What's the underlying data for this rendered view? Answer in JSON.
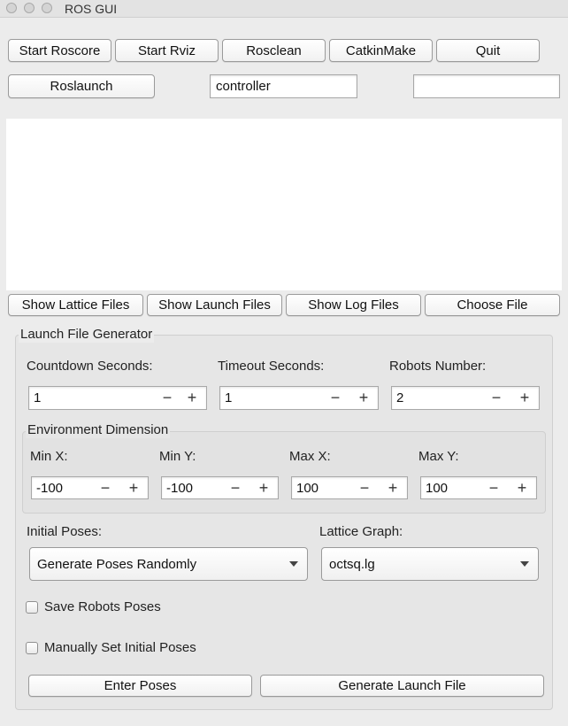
{
  "window": {
    "title": "ROS GUI"
  },
  "toolbar": {
    "row1": [
      "Start Roscore",
      "Start Rviz",
      "Rosclean",
      "CatkinMake",
      "Quit"
    ],
    "roslaunch_label": "Roslaunch",
    "package_value": "controller",
    "file_value": ""
  },
  "output": {
    "text": ""
  },
  "files": [
    "Show Lattice Files",
    "Show Launch Files",
    "Show Log Files",
    "Choose File"
  ],
  "generator": {
    "title": "Launch File Generator",
    "countdown": {
      "label": "Countdown Seconds:",
      "value": "1"
    },
    "timeout": {
      "label": "Timeout Seconds:",
      "value": "1"
    },
    "robots": {
      "label": "Robots Number:",
      "value": "2"
    },
    "env": {
      "title": "Environment Dimension",
      "min_x": {
        "label": "Min X:",
        "value": "-100"
      },
      "min_y": {
        "label": "Min Y:",
        "value": "-100"
      },
      "max_x": {
        "label": "Max X:",
        "value": "100"
      },
      "max_y": {
        "label": "Max Y:",
        "value": "100"
      }
    },
    "initial_poses": {
      "label": "Initial Poses:",
      "value": "Generate Poses Randomly"
    },
    "lattice_graph": {
      "label": "Lattice Graph:",
      "value": "octsq.lg"
    },
    "save_poses": {
      "label": "Save Robots Poses",
      "checked": false
    },
    "manual_poses": {
      "label": "Manually Set Initial Poses",
      "checked": false
    },
    "enter_poses_label": "Enter Poses",
    "generate_label": "Generate Launch File"
  },
  "symbols": {
    "minus": "−",
    "plus": "+"
  }
}
